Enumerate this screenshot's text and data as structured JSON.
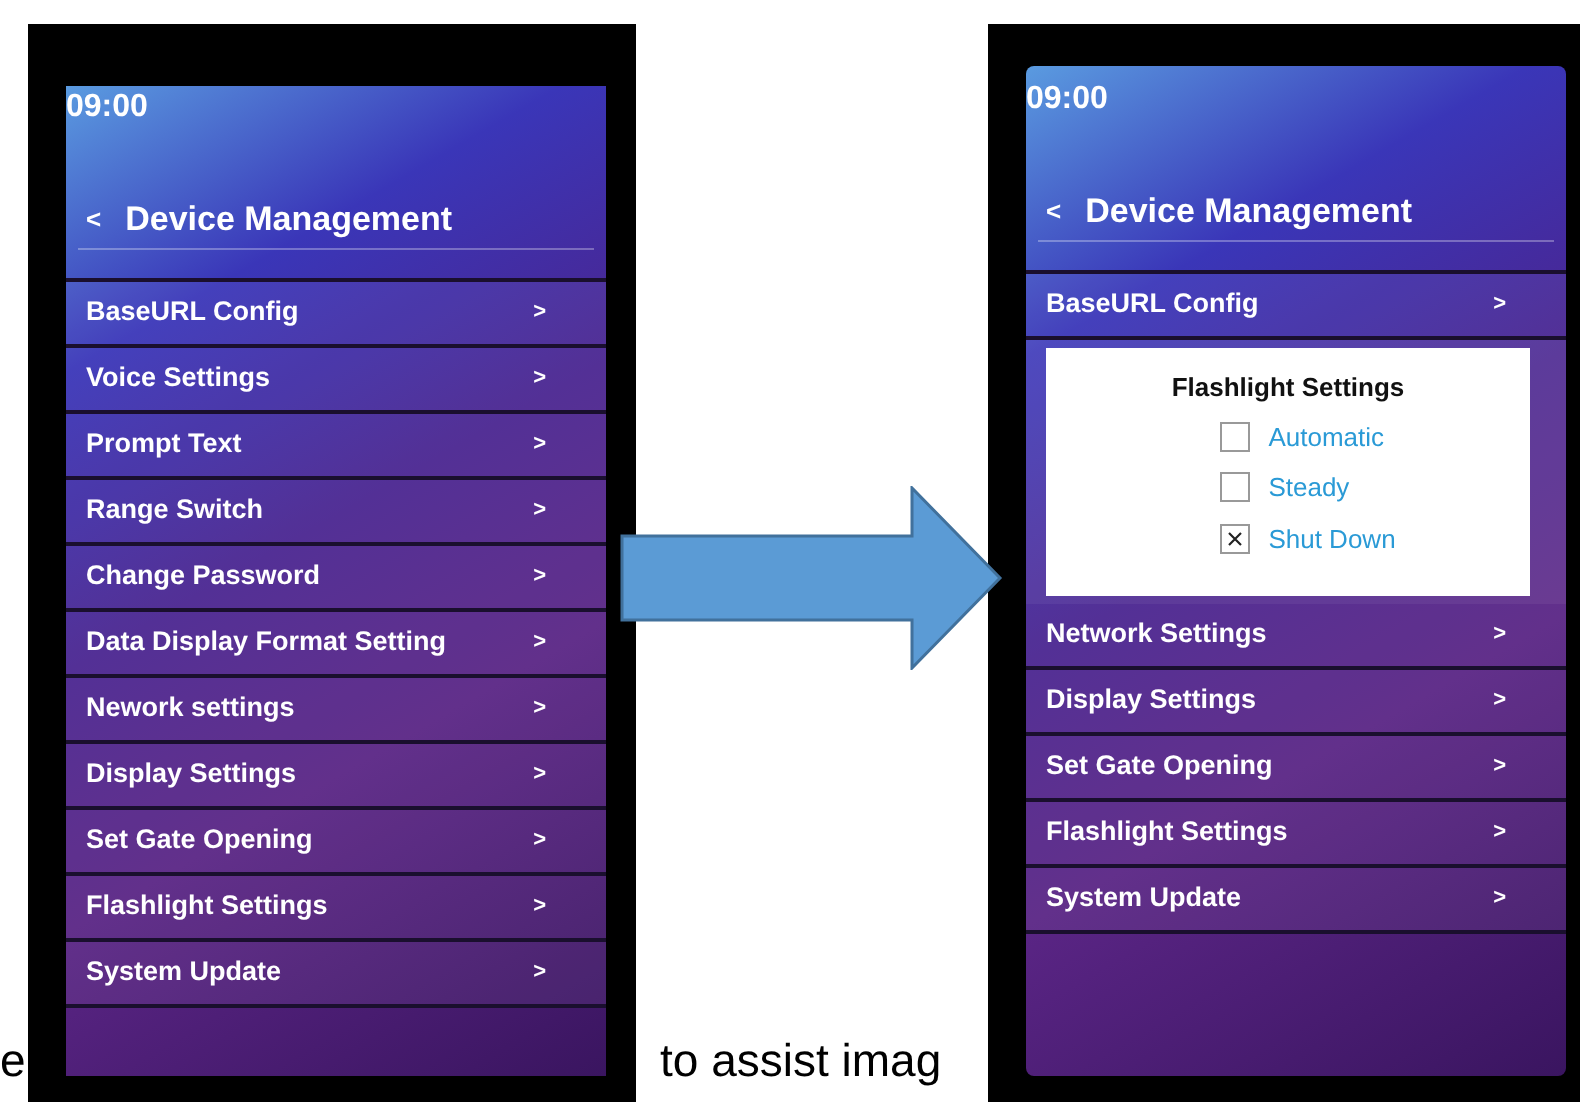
{
  "screens": [
    {
      "time": "09:00",
      "back": "<",
      "title": "Device Management",
      "items_above": [
        {
          "label": "BaseURL Config",
          "chevron": ">"
        },
        {
          "label": "Voice Settings",
          "chevron": ">"
        },
        {
          "label": "Prompt Text",
          "chevron": ">"
        },
        {
          "label": "Range Switch",
          "chevron": ">"
        },
        {
          "label": "Change Password",
          "chevron": ">"
        },
        {
          "label": "Data Display Format Setting",
          "chevron": ">"
        },
        {
          "label": "Nework settings",
          "chevron": ">"
        },
        {
          "label": "Display Settings",
          "chevron": ">"
        },
        {
          "label": "Set Gate Opening",
          "chevron": ">"
        },
        {
          "label": "Flashlight Settings",
          "chevron": ">"
        },
        {
          "label": "System Update",
          "chevron": ">"
        }
      ]
    },
    {
      "time": "09:00",
      "back": "<",
      "title": "Device Management",
      "items_above": [
        {
          "label": "BaseURL Config",
          "chevron": ">"
        }
      ],
      "dialog": {
        "title": "Flashlight Settings",
        "options": [
          {
            "label": "Automatic",
            "checked": false
          },
          {
            "label": "Steady",
            "checked": false
          },
          {
            "label": "Shut Down",
            "checked": true
          }
        ]
      },
      "items_below": [
        {
          "label": "Network Settings",
          "chevron": ">"
        },
        {
          "label": "Display Settings",
          "chevron": ">"
        },
        {
          "label": "Set Gate Opening",
          "chevron": ">"
        },
        {
          "label": "Flashlight Settings",
          "chevron": ">"
        },
        {
          "label": "System Update",
          "chevron": ">"
        }
      ]
    }
  ],
  "caption_fragments": [
    "e",
    "to assist imag"
  ]
}
